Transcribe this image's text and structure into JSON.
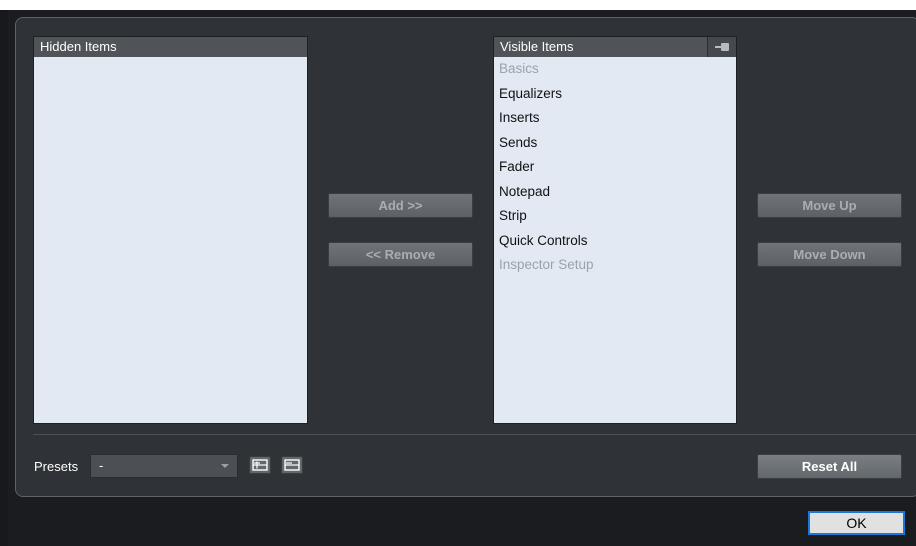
{
  "hidden_list": {
    "header": "Hidden Items",
    "items": []
  },
  "visible_list": {
    "header": "Visible Items",
    "items": [
      {
        "label": "Basics",
        "enabled": false
      },
      {
        "label": "Equalizers",
        "enabled": true
      },
      {
        "label": "Inserts",
        "enabled": true
      },
      {
        "label": "Sends",
        "enabled": true
      },
      {
        "label": "Fader",
        "enabled": true
      },
      {
        "label": "Notepad",
        "enabled": true
      },
      {
        "label": "Strip",
        "enabled": true
      },
      {
        "label": "Quick Controls",
        "enabled": true
      },
      {
        "label": "Inspector Setup",
        "enabled": false
      }
    ]
  },
  "buttons": {
    "add": "Add >>",
    "remove": "<< Remove",
    "move_up": "Move Up",
    "move_down": "Move Down",
    "reset_all": "Reset All",
    "ok": "OK"
  },
  "presets": {
    "label": "Presets",
    "value": "-"
  },
  "icons": {
    "pin": "pin-icon",
    "save_preset": "save-preset-icon",
    "delete_preset": "delete-preset-icon",
    "dropdown": "chevron-down-icon"
  },
  "colors": {
    "panel_bg": "#2f3337",
    "list_bg": "#e2e9f2",
    "header_bg": "#505458",
    "disabled_text": "#9aa2ab",
    "ok_focus": "#1c78d6"
  }
}
